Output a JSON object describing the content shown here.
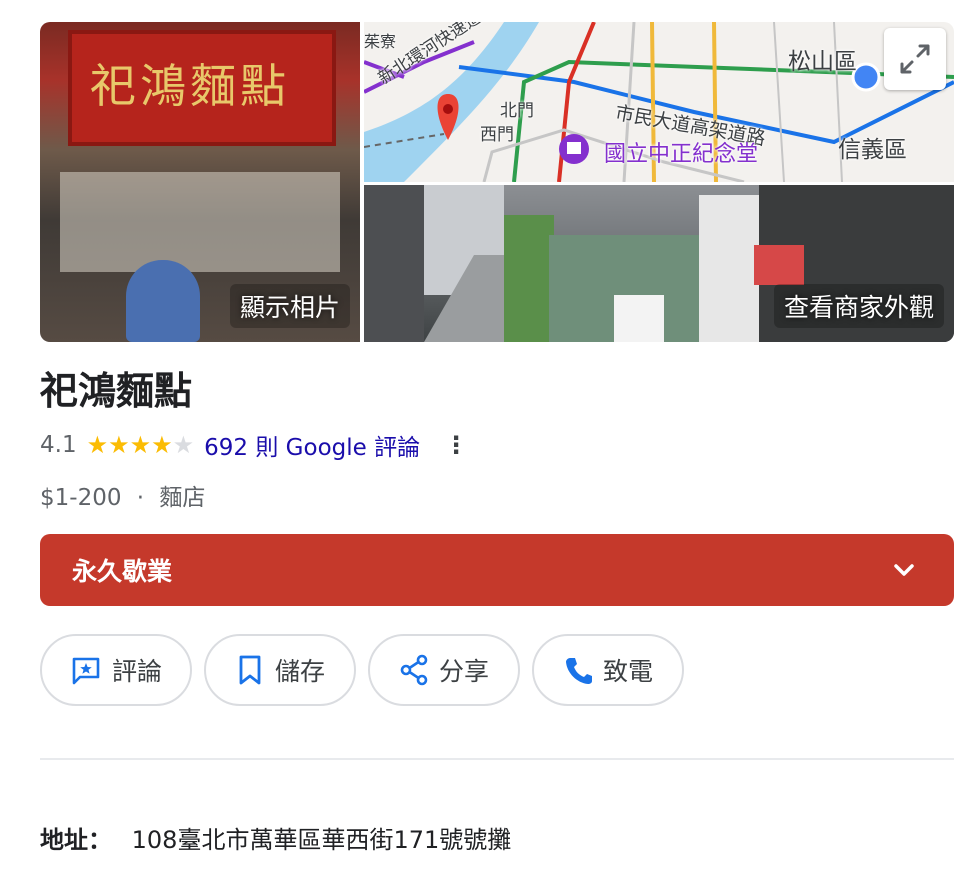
{
  "photos": {
    "store_sign_text": "祀鴻麵點",
    "show_photos_label": "顯示相片",
    "street_view_label": "查看商家外觀"
  },
  "map": {
    "labels": {
      "songshan": "松山區",
      "xinyi": "信義區",
      "highway": "新北環河快速道",
      "beimen": "北門",
      "ximen": "西門",
      "civic": "市民大道高架道路",
      "poi": "國立中正紀念堂",
      "tiliao": "茱寮"
    }
  },
  "business": {
    "name": "祀鴻麵點",
    "rating": "4.1",
    "rating_stars": 4.1,
    "reviews_link": "692 則 Google 評論",
    "price": "$1-200",
    "separator": "·",
    "category": "麵店"
  },
  "status": {
    "label": "永久歇業",
    "color": "#c5392b"
  },
  "actions": [
    {
      "label": "評論",
      "icon": "review-icon"
    },
    {
      "label": "儲存",
      "icon": "bookmark-icon"
    },
    {
      "label": "分享",
      "icon": "share-icon"
    },
    {
      "label": "致電",
      "icon": "phone-icon"
    }
  ],
  "address": {
    "label": "地址：",
    "value": "108臺北市萬華區華西街171號號攤"
  },
  "colors": {
    "accent_link": "#1a0dab",
    "star": "#fbbc04",
    "action_icon": "#1a73e8"
  }
}
